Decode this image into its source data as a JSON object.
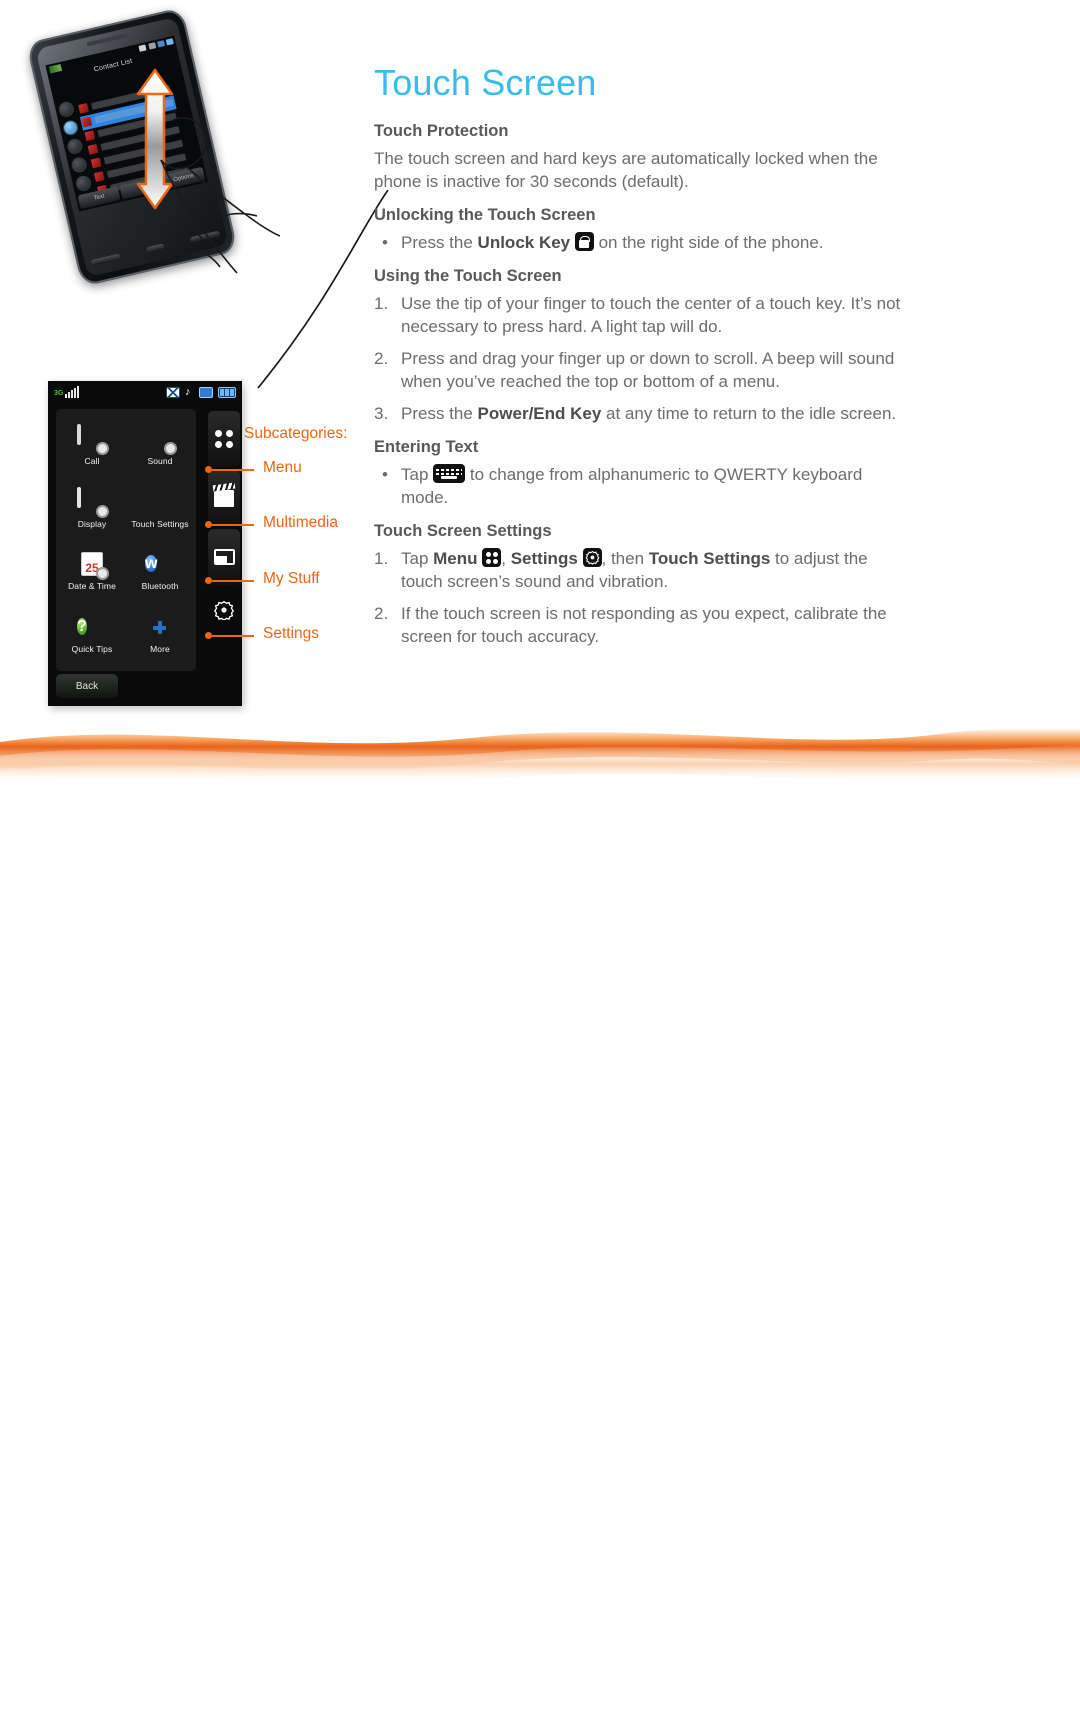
{
  "page": {
    "title": "Touch Screen",
    "title_color": "#36bdf0",
    "accent_orange": "#ee6611"
  },
  "sections": [
    {
      "heading": "Touch Protection",
      "type": "paragraph",
      "text": "The touch screen and hard keys are automatically locked when the phone is inactive for 30 seconds (default)."
    },
    {
      "heading": "Unlocking the Touch Screen",
      "type": "bullets",
      "items": [
        {
          "marker": "•",
          "pre": "Press the ",
          "bold": "Unlock Key",
          "icon": "lock-icon",
          "post": " on the right side of the phone."
        }
      ]
    },
    {
      "heading": "Using the Touch Screen",
      "type": "numbered",
      "items": [
        {
          "marker": "1.",
          "pre": "Use the tip of your finger to touch the center of a touch key. It’s not necessary to press hard. A light tap will do.",
          "bold": "",
          "post": ""
        },
        {
          "marker": "2.",
          "pre": "Press and drag your finger up or down to scroll. A beep will sound when you’ve reached the top or bottom of a menu.",
          "bold": "",
          "post": ""
        },
        {
          "marker": "3.",
          "pre": "Press the ",
          "bold": "Power/End Key",
          "post": " at any time to return to the idle screen."
        }
      ]
    },
    {
      "heading": "Entering Text",
      "type": "bullets",
      "items": [
        {
          "marker": "•",
          "pre": "Tap ",
          "icon": "keyboard-icon",
          "post": " to change from alphanumeric to QWERTY keyboard mode."
        }
      ]
    },
    {
      "heading": "Touch Screen Settings",
      "type": "numbered",
      "items": [
        {
          "marker": "1.",
          "text_parts": [
            "Tap ",
            "Menu",
            " , ",
            "Settings",
            " , then ",
            "Touch Settings",
            " to adjust the touch screen’s sound and vibration."
          ]
        },
        {
          "marker": "2.",
          "text_parts": [
            "If the touch screen is not responding as you expect, calibrate the screen for touch accuracy."
          ]
        }
      ]
    }
  ],
  "text_runs": {
    "s1_p": "The touch screen and hard keys are automatically locked when the phone is inactive for 30 seconds (default).",
    "s2_pre": "Press the ",
    "s2_bold": "Unlock Key",
    "s2_post": " on the right side of the phone.",
    "s3_i1": "Use the tip of your finger to touch the center of a touch key. It’s not necessary to press hard. A light tap will do.",
    "s3_i2": "Press and drag your finger up or down to scroll. A beep will sound when you’ve reached the top or bottom of a menu.",
    "s3_i3_pre": "Press the ",
    "s3_i3_bold": "Power/End Key",
    "s3_i3_post": " at any time to return to the idle screen.",
    "s4_pre": "Tap ",
    "s4_post": " to change from alphanumeric to QWERTY keyboard mode.",
    "s5_i1_a": "Tap ",
    "s5_i1_menu": "Menu",
    "s5_i1_b": ", ",
    "s5_i1_settings": "Settings",
    "s5_i1_c": ", then ",
    "s5_i1_touch": "Touch Settings",
    "s5_i1_d": " to adjust the touch screen’s sound and vibration.",
    "s5_i2": "If the touch screen is not responding as you expect, calibrate the screen for touch accuracy.",
    "m1": "•",
    "m2": "1.",
    "m3": "2.",
    "m4": "3."
  },
  "headings": {
    "h1": "Touch Protection",
    "h2": "Unlocking the Touch Screen",
    "h3": "Using the Touch Screen",
    "h4": "Entering Text",
    "h5": "Touch Screen Settings"
  },
  "phone_photo": {
    "screen_title": "Contact List",
    "softkeys": [
      "Text",
      "☆",
      "Options"
    ]
  },
  "menu_screenshot": {
    "status_icons": [
      "signal-3g-icon",
      "message-icon",
      "music-note-icon",
      "window-icon",
      "battery-icon"
    ],
    "items": [
      {
        "label": "Call",
        "icon": "call-settings-icon"
      },
      {
        "label": "Sound",
        "icon": "sound-settings-icon"
      },
      {
        "label": "Display",
        "icon": "display-settings-icon"
      },
      {
        "label": "Touch Settings",
        "icon": "touch-settings-icon"
      },
      {
        "label": "Date & Time",
        "icon": "date-time-icon"
      },
      {
        "label": "Bluetooth",
        "icon": "bluetooth-icon"
      },
      {
        "label": "Quick Tips",
        "icon": "quick-tips-icon"
      },
      {
        "label": "More",
        "icon": "more-icon"
      }
    ],
    "tabs": [
      {
        "icon": "menu-dots-icon"
      },
      {
        "icon": "multimedia-film-icon"
      },
      {
        "icon": "my-stuff-folder-icon"
      },
      {
        "icon": "settings-gear-icon"
      }
    ],
    "back_label": "Back",
    "date_icon_day": "25"
  },
  "callouts": {
    "subcategories": "Subcategories:",
    "menu": "Menu",
    "multimedia": "Multimedia",
    "my_stuff": "My Stuff",
    "settings": "Settings"
  }
}
